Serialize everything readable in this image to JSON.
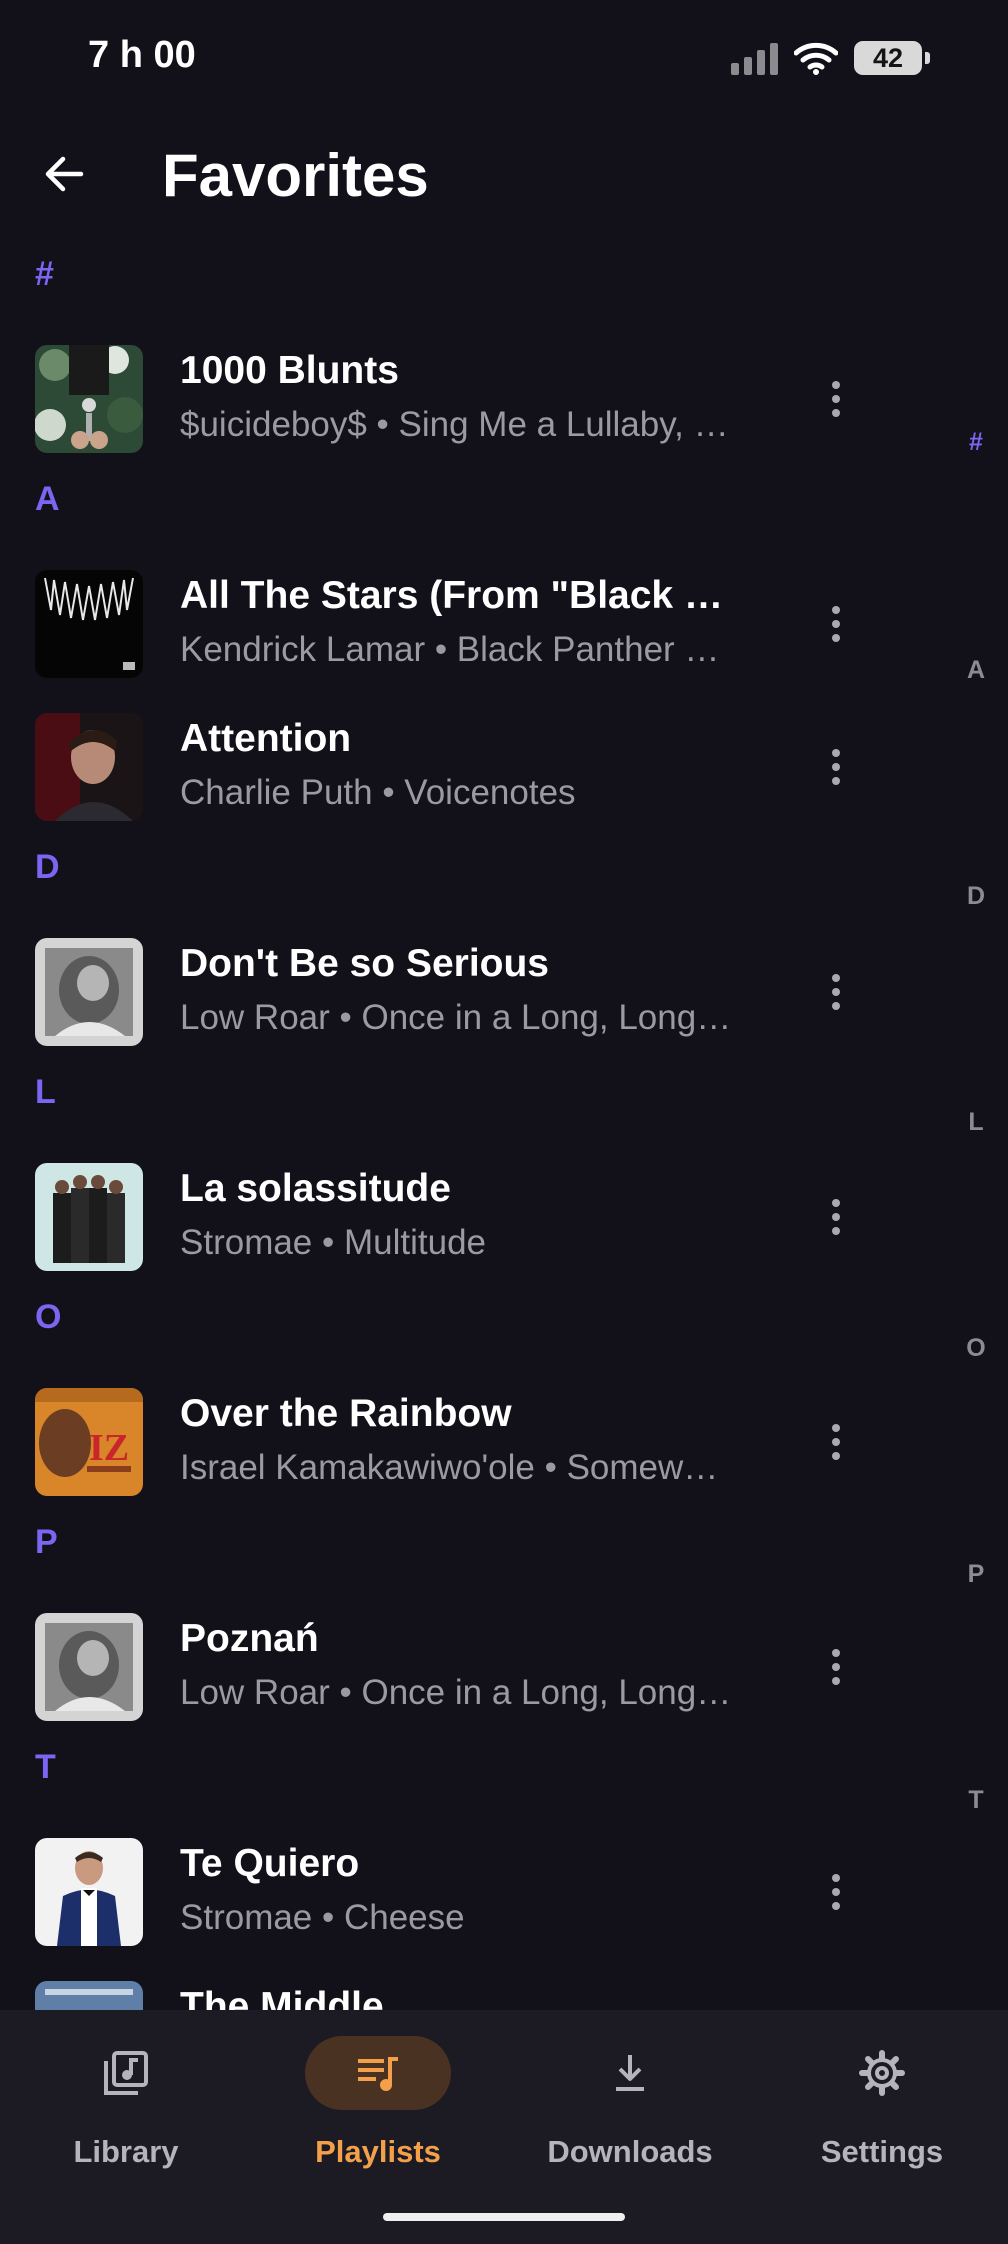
{
  "status_bar": {
    "time": "7 h 00",
    "battery": "42",
    "icons": [
      "signal-icon",
      "wifi-icon",
      "battery-icon"
    ]
  },
  "top_bar": {
    "back_icon": "arrow-left-icon",
    "title": "Favorites"
  },
  "sections": [
    {
      "letter": "#",
      "tracks": [
        {
          "title": "1000 Blunts",
          "subtitle": "$uicideboy$ • Sing Me a Lullaby, …"
        }
      ]
    },
    {
      "letter": "A",
      "tracks": [
        {
          "title": "All The Stars (From \"Black P…",
          "subtitle": "Kendrick Lamar • Black Panther …"
        },
        {
          "title": "Attention",
          "subtitle": "Charlie Puth • Voicenotes"
        }
      ]
    },
    {
      "letter": "D",
      "tracks": [
        {
          "title": "Don't Be so Serious",
          "subtitle": "Low Roar • Once in a Long, Long…"
        }
      ]
    },
    {
      "letter": "L",
      "tracks": [
        {
          "title": "La solassitude",
          "subtitle": "Stromae • Multitude"
        }
      ]
    },
    {
      "letter": "O",
      "tracks": [
        {
          "title": "Over the Rainbow",
          "subtitle": "Israel Kamakawiwo'ole • Somew…"
        }
      ]
    },
    {
      "letter": "P",
      "tracks": [
        {
          "title": "Poznań",
          "subtitle": "Low Roar • Once in a Long, Long…"
        }
      ]
    },
    {
      "letter": "T",
      "tracks": [
        {
          "title": "Te Quiero",
          "subtitle": "Stromae • Cheese"
        },
        {
          "title": "The Middle",
          "subtitle": ""
        }
      ]
    }
  ],
  "index_bar": [
    "#",
    "A",
    "D",
    "L",
    "O",
    "P",
    "T"
  ],
  "bottom_nav": {
    "items": [
      {
        "label": "Library",
        "icon": "library-music-icon"
      },
      {
        "label": "Playlists",
        "icon": "queue-music-icon"
      },
      {
        "label": "Downloads",
        "icon": "download-icon"
      },
      {
        "label": "Settings",
        "icon": "gear-icon"
      }
    ],
    "active": "Playlists"
  },
  "colors": {
    "background": "#12111a",
    "accent": "#7b66f2",
    "nav_active": "#f4a04b",
    "nav_pill": "#4a3222",
    "subtitle": "#9b9aa3"
  }
}
